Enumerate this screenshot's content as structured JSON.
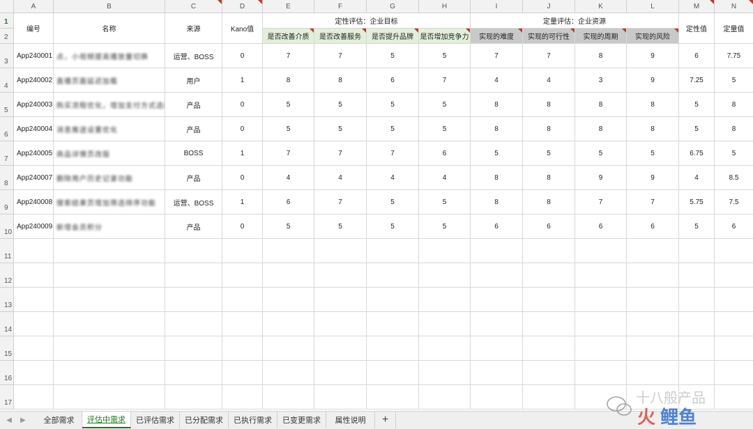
{
  "columns": [
    "A",
    "B",
    "C",
    "D",
    "E",
    "F",
    "G",
    "H",
    "I",
    "J",
    "K",
    "L",
    "M",
    "N"
  ],
  "header": {
    "id": "编号",
    "name": "名称",
    "source": "来源",
    "kano": "Kano值",
    "qualitative_group": "定性评估：企业目标",
    "quantitative_group": "定量评估：企业资源",
    "qual_value": "定性值",
    "quant_value": "定量值",
    "qualitative": [
      "是否改善介质",
      "是否改善服务",
      "是否提升品牌",
      "是否增加竞争力"
    ],
    "quantitative": [
      "实现的难度",
      "实现的可行性",
      "实现的周期",
      "实现的风险"
    ]
  },
  "rows": [
    {
      "n": "3",
      "cells": [
        "App240001",
        "点，小视频提高播放量切换",
        "运营、BOSS",
        "0",
        "7",
        "7",
        "5",
        "5",
        "7",
        "7",
        "8",
        "9",
        "6",
        "7.75"
      ]
    },
    {
      "n": "4",
      "cells": [
        "App240002",
        "直播页面延迟加载",
        "用户",
        "1",
        "8",
        "8",
        "6",
        "7",
        "4",
        "4",
        "3",
        "9",
        "7.25",
        "5"
      ]
    },
    {
      "n": "5",
      "cells": [
        "App240003",
        "购买流程优化，增加支付方式选择",
        "产品",
        "0",
        "5",
        "5",
        "5",
        "5",
        "8",
        "8",
        "8",
        "8",
        "5",
        "8"
      ]
    },
    {
      "n": "6",
      "cells": [
        "App240004",
        "消息推送设置优化",
        "产品",
        "0",
        "5",
        "5",
        "5",
        "5",
        "8",
        "8",
        "8",
        "8",
        "5",
        "8"
      ]
    },
    {
      "n": "7",
      "cells": [
        "App240005",
        "商品详情页改版",
        "BOSS",
        "1",
        "7",
        "7",
        "7",
        "6",
        "5",
        "5",
        "5",
        "5",
        "6.75",
        "5"
      ]
    },
    {
      "n": "8",
      "cells": [
        "App240007",
        "删除用户历史记录功能",
        "产品",
        "0",
        "4",
        "4",
        "4",
        "4",
        "8",
        "8",
        "9",
        "9",
        "4",
        "8.5"
      ]
    },
    {
      "n": "9",
      "cells": [
        "App240008",
        "搜索结果页增加筛选排序功能",
        "运营、BOSS",
        "1",
        "6",
        "7",
        "5",
        "5",
        "8",
        "8",
        "7",
        "7",
        "5.75",
        "7.5"
      ]
    },
    {
      "n": "10",
      "cells": [
        "App240009",
        "新增会员积分",
        "产品",
        "0",
        "5",
        "5",
        "5",
        "5",
        "6",
        "6",
        "6",
        "6",
        "5",
        "6"
      ]
    }
  ],
  "empty_rows": [
    "11",
    "12",
    "13",
    "14",
    "15",
    "16",
    "17"
  ],
  "header_rows": [
    "1",
    "2"
  ],
  "tabs": [
    {
      "label": "全部需求",
      "active": false
    },
    {
      "label": "评估中需求",
      "active": true
    },
    {
      "label": "已评估需求",
      "active": false
    },
    {
      "label": "已分配需求",
      "active": false
    },
    {
      "label": "已执行需求",
      "active": false
    },
    {
      "label": "已变更需求",
      "active": false
    },
    {
      "label": "属性说明",
      "active": false
    }
  ],
  "add_tab": "+",
  "watermark": "十八般产品",
  "colors": {
    "green": "#e2efd9",
    "grey": "#c9c9c9",
    "accent": "#1a7a1a",
    "comment": "#c0392b"
  }
}
